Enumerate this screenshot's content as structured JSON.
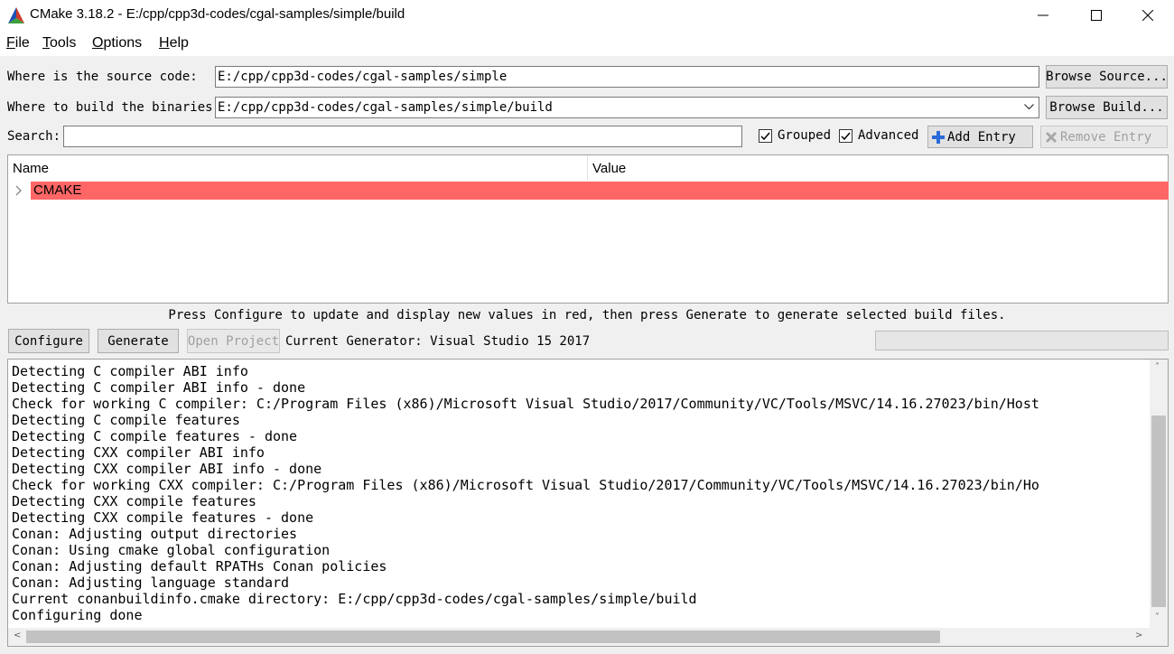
{
  "window": {
    "title": "CMake 3.18.2 - E:/cpp/cpp3d-codes/cgal-samples/simple/build",
    "minimize_icon": "minimize-icon",
    "maximize_icon": "maximize-icon",
    "close_icon": "close-icon"
  },
  "menu": {
    "file": {
      "mnemonic": "F",
      "rest": "ile"
    },
    "tools": {
      "mnemonic": "T",
      "rest": "ools"
    },
    "options": {
      "mnemonic": "O",
      "rest": "ptions"
    },
    "help": {
      "mnemonic": "H",
      "rest": "elp"
    }
  },
  "source": {
    "label": "Where is the source code:",
    "value": "E:/cpp/cpp3d-codes/cgal-samples/simple",
    "browse_label": "Browse Source..."
  },
  "build": {
    "label": "Where to build the binaries:",
    "value": "E:/cpp/cpp3d-codes/cgal-samples/simple/build",
    "browse_label": "Browse Build..."
  },
  "search": {
    "label": "Search:",
    "value": "",
    "grouped_label": "Grouped",
    "grouped_checked": true,
    "advanced_label": "Advanced",
    "advanced_checked": true,
    "add_entry_label": "Add Entry",
    "remove_entry_label": "Remove Entry"
  },
  "table": {
    "columns": [
      "Name",
      "Value"
    ],
    "rows": [
      {
        "name": "CMAKE",
        "value": "",
        "highlight": "#ff6666"
      }
    ]
  },
  "hint": "Press Configure to update and display new values in red, then press Generate to generate selected build files.",
  "actions": {
    "configure": "Configure",
    "generate": "Generate",
    "open_project": "Open Project",
    "generator_text": "Current Generator: Visual Studio 15 2017"
  },
  "log": [
    "Detecting C compiler ABI info",
    "Detecting C compiler ABI info - done",
    "Check for working C compiler: C:/Program Files (x86)/Microsoft Visual Studio/2017/Community/VC/Tools/MSVC/14.16.27023/bin/Host",
    "Detecting C compile features",
    "Detecting C compile features - done",
    "Detecting CXX compiler ABI info",
    "Detecting CXX compiler ABI info - done",
    "Check for working CXX compiler: C:/Program Files (x86)/Microsoft Visual Studio/2017/Community/VC/Tools/MSVC/14.16.27023/bin/Ho",
    "Detecting CXX compile features",
    "Detecting CXX compile features - done",
    "Conan: Adjusting output directories",
    "Conan: Using cmake global configuration",
    "Conan: Adjusting default RPATHs Conan policies",
    "Conan: Adjusting language standard",
    "Current conanbuildinfo.cmake directory: E:/cpp/cpp3d-codes/cgal-samples/simple/build",
    "Configuring done"
  ],
  "colors": {
    "highlight_row": "#ff6666",
    "add_icon": "#2a6ad8"
  }
}
